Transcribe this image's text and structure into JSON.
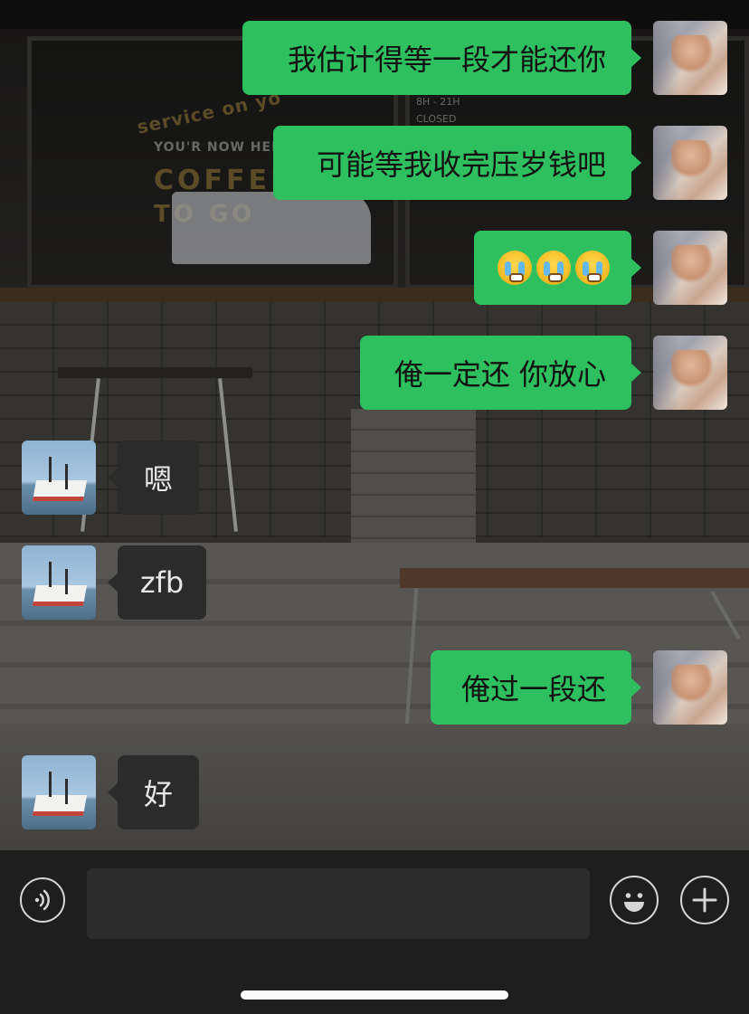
{
  "background": {
    "sign_top": "service on yo",
    "sign_now": "YOU'R NOW HERE",
    "sign_coffee": "COFFEE",
    "sign_togo": "TO GO",
    "hours": "8H - 21H",
    "closed": "CLOSED"
  },
  "messages": [
    {
      "side": "out",
      "text": "我估计得等一段才能还你"
    },
    {
      "side": "out",
      "text": "可能等我收完压岁钱吧"
    },
    {
      "side": "out",
      "emoji": [
        "crying-face",
        "crying-face",
        "crying-face"
      ]
    },
    {
      "side": "out",
      "text": "俺一定还 你放心"
    },
    {
      "side": "in",
      "text": "嗯"
    },
    {
      "side": "in",
      "text": "zfb"
    },
    {
      "side": "out",
      "text": "俺过一段还"
    },
    {
      "side": "in",
      "text": "好"
    }
  ],
  "input_bar": {
    "voice_icon": "voice-icon",
    "text_value": "",
    "emoji_icon": "emoji-icon",
    "plus_icon": "plus-icon"
  },
  "colors": {
    "outgoing_bubble": "#2ec05f",
    "incoming_bubble": "#2b2b2b",
    "input_bar": "#1e1e1e"
  }
}
